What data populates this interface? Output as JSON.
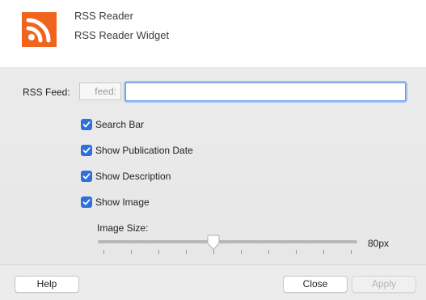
{
  "header": {
    "title": "RSS Reader",
    "subtitle": "RSS Reader Widget",
    "icon": "rss-icon",
    "icon_color": "#f0641e"
  },
  "feed": {
    "label": "RSS Feed:",
    "prefix": "feed:",
    "value": "",
    "placeholder": ""
  },
  "options": [
    {
      "label": "Search Bar",
      "checked": true
    },
    {
      "label": "Show Publication Date",
      "checked": true
    },
    {
      "label": "Show Description",
      "checked": true
    },
    {
      "label": "Show Image",
      "checked": true
    }
  ],
  "image_size": {
    "label": "Image Size:",
    "value_text": "80px",
    "slider_fraction": 0.44
  },
  "buttons": {
    "help": "Help",
    "close": "Close",
    "apply": "Apply"
  },
  "colors": {
    "accent": "#2d6fdc",
    "focus_ring": "#9ebfef"
  }
}
